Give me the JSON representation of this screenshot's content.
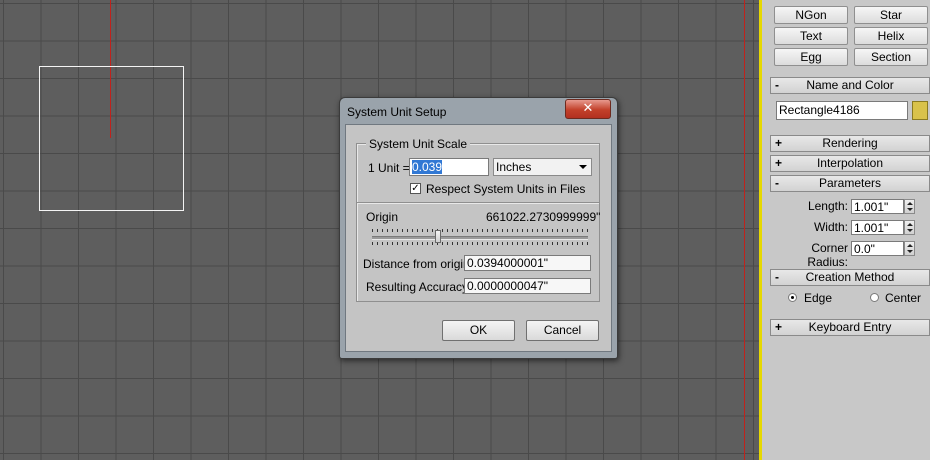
{
  "create_panel": {
    "object_buttons": [
      "NGon",
      "Star",
      "Text",
      "Helix",
      "Egg",
      "Section"
    ]
  },
  "rollouts": {
    "name_and_color": {
      "sign": "-",
      "label": "Name and Color",
      "object_name": "Rectangle4186",
      "color_swatch": "#d9c24a"
    },
    "rendering": {
      "sign": "+",
      "label": "Rendering"
    },
    "interpolation": {
      "sign": "+",
      "label": "Interpolation"
    },
    "parameters": {
      "sign": "-",
      "label": "Parameters",
      "length_label": "Length:",
      "length_value": "1.001\"",
      "width_label": "Width:",
      "width_value": "1.001\"",
      "corner_radius_label": "Corner Radius:",
      "corner_radius_value": "0.0\""
    },
    "creation_method": {
      "sign": "-",
      "label": "Creation Method",
      "edge": "Edge",
      "center": "Center",
      "selected": "Edge"
    },
    "keyboard_entry": {
      "sign": "+",
      "label": "Keyboard Entry"
    }
  },
  "dialog": {
    "title": "System Unit Setup",
    "close_glyph": "✕",
    "scale_group": "System Unit Scale",
    "unit_label": "1 Unit =",
    "unit_value": "0.039",
    "unit_type": "Inches",
    "respect_units_label": "Respect System Units in Files",
    "respect_units_checked": "✓",
    "origin_label": "Origin",
    "origin_value": "661022.2730999999\"",
    "origin_slider_fraction": 0.3,
    "distance_label": "Distance from origin:",
    "distance_value": "0.0394000001\"",
    "accuracy_label": "Resulting Accuracy:",
    "accuracy_value": "0.0000000047\"",
    "ok_label": "OK",
    "cancel_label": "Cancel"
  },
  "colors": {
    "viewport_bg": "#5e5e5e",
    "active_viewport_border": "#e6d800",
    "shape_color": "#f4f4f4",
    "axis_red": "#c0221c"
  }
}
